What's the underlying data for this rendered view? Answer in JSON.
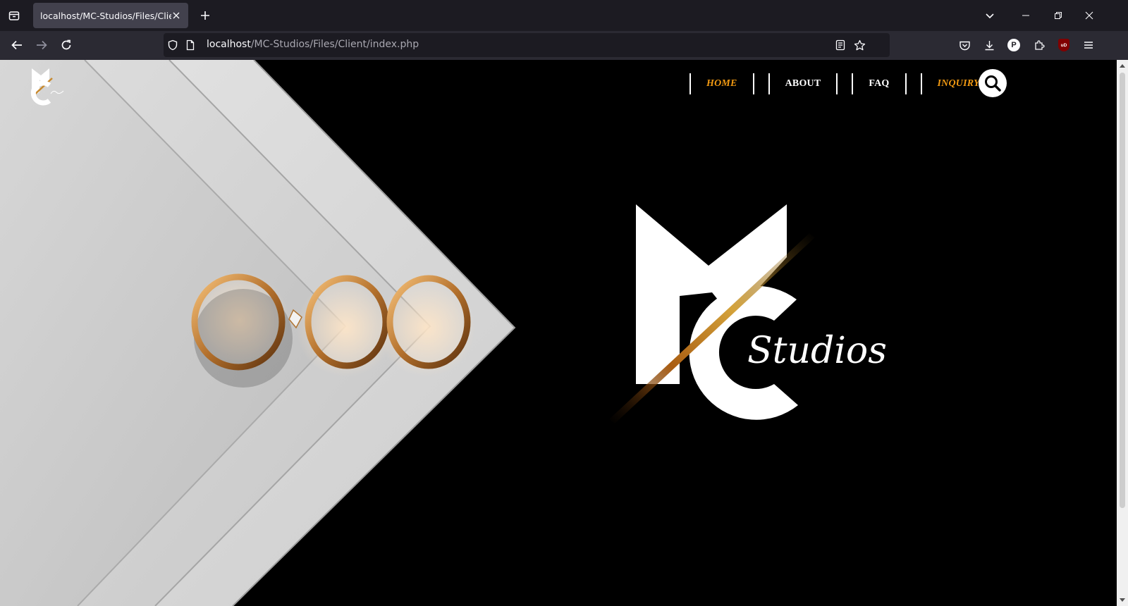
{
  "browser": {
    "tab_title": "localhost/MC-Studios/Files/Client/",
    "url_host": "localhost",
    "url_path": "/MC-Studios/Files/Client/index.php",
    "extension_badge": "P",
    "ublock_badge": "uD"
  },
  "site": {
    "logo_alt": "MC Studios",
    "nav": [
      {
        "label": "HOME",
        "active": true
      },
      {
        "label": "ABOUT",
        "active": false
      },
      {
        "label": "FAQ",
        "active": false
      },
      {
        "label": "INQUIRY",
        "active": true
      }
    ],
    "brand_script": "Studios",
    "accent_color": "#f29a12"
  }
}
